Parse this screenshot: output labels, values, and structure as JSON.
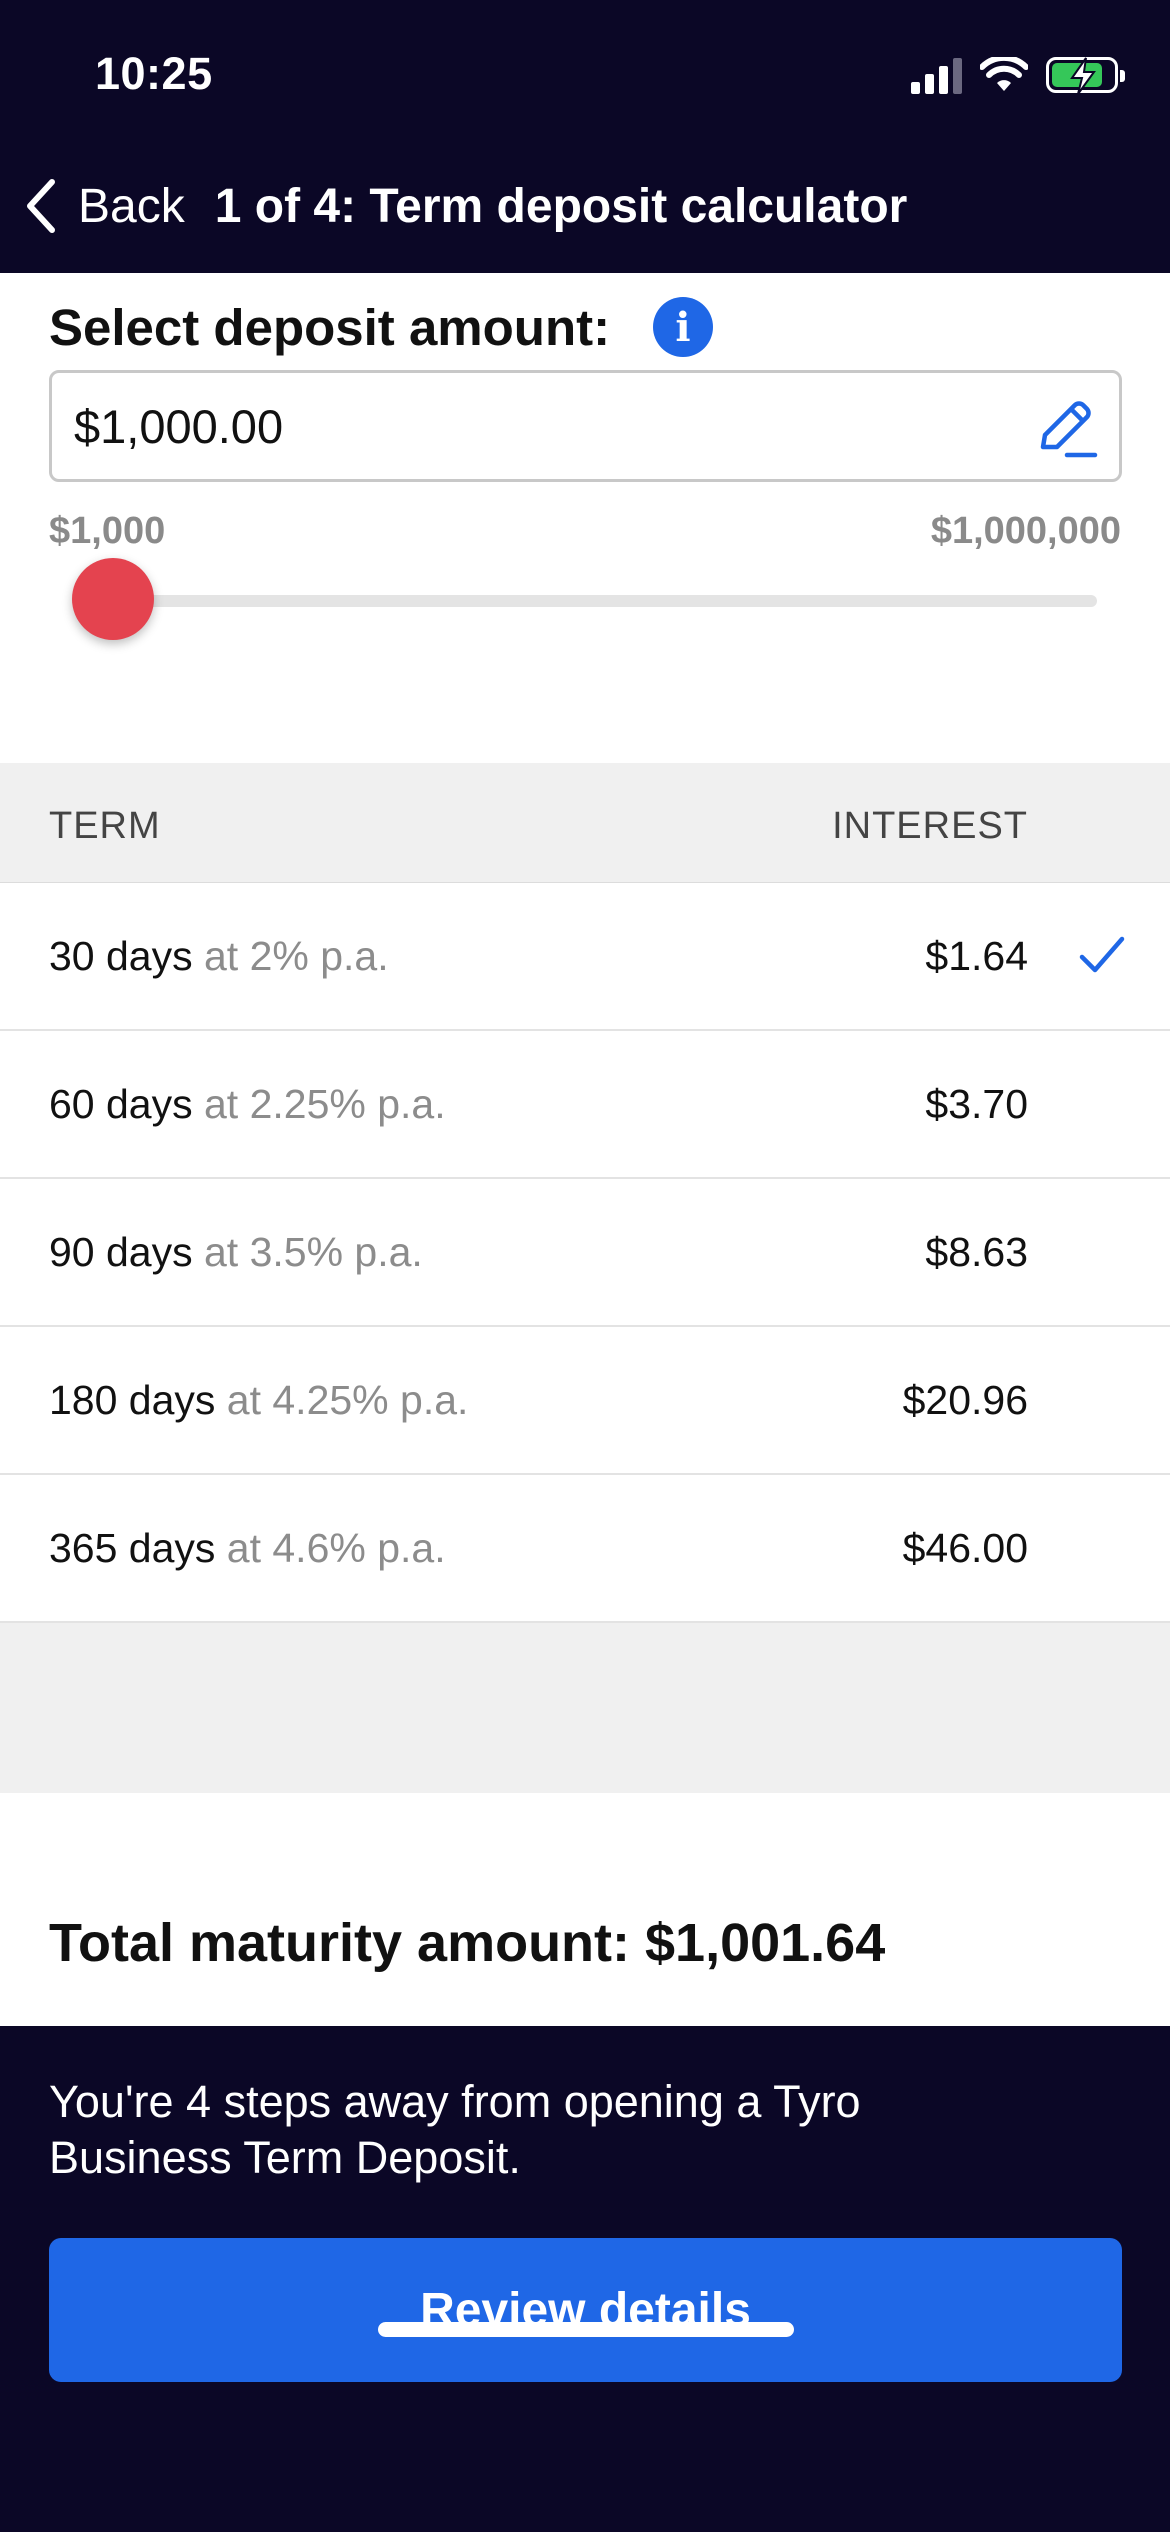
{
  "status_bar": {
    "time": "10:25",
    "icons": [
      "signal-icon",
      "wifi-icon",
      "battery-charging-icon"
    ]
  },
  "nav": {
    "back_label": "Back",
    "title": "1 of 4: Term deposit calculator"
  },
  "amount": {
    "label": "Select deposit amount:",
    "value": "$1,000.00",
    "range_min": "$1,000",
    "range_max": "$1,000,000",
    "slider_fraction": 0
  },
  "table": {
    "headers": {
      "term": "TERM",
      "interest": "INTEREST"
    },
    "rows": [
      {
        "term": "30 days",
        "rate": " at 2% p.a.",
        "interest": "$1.64",
        "selected": true
      },
      {
        "term": "60 days",
        "rate": " at 2.25% p.a.",
        "interest": "$3.70",
        "selected": false
      },
      {
        "term": "90 days",
        "rate": " at 3.5% p.a.",
        "interest": "$8.63",
        "selected": false
      },
      {
        "term": "180 days",
        "rate": " at 4.25% p.a.",
        "interest": "$20.96",
        "selected": false
      },
      {
        "term": "365 days",
        "rate": " at 4.6% p.a.",
        "interest": "$46.00",
        "selected": false
      }
    ]
  },
  "total": {
    "text": "Total maturity amount: $1,001.64"
  },
  "footer": {
    "text": "You're 4 steps away from opening a Tyro Business Term Deposit.",
    "button_label": "Review details"
  },
  "colors": {
    "header_bg": "#0b0726",
    "accent_blue": "#1f67e6",
    "slider_thumb": "#e4434f",
    "battery_green": "#35c759"
  }
}
